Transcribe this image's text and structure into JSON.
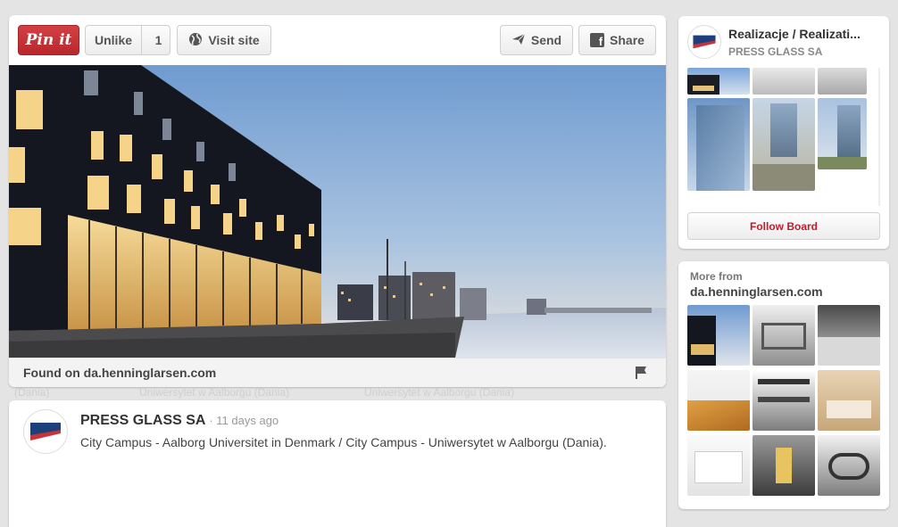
{
  "pin": {
    "pin_it_label": "Pin it",
    "unlike_label": "Unlike",
    "like_count": "1",
    "visit_label": "Visit site",
    "send_label": "Send",
    "share_label": "Share",
    "found_on": "Found on da.henninglarsen.com"
  },
  "description": {
    "author": "PRESS GLASS SA",
    "time": "· 11 days ago",
    "text": "City Campus - Aalborg Universitet in Denmark / City Campus - Uniwersytet w Aalborgu (Dania)."
  },
  "board": {
    "title": "Realizacje / Realizati...",
    "owner": "PRESS GLASS SA",
    "follow_label": "Follow Board"
  },
  "more": {
    "label": "More from",
    "domain": "da.henninglarsen.com"
  },
  "ghost": {
    "a": "Uniwersytet w Aalborgu (Dania)",
    "b": "Uniwersytet w Aalborgu (Dania)",
    "c": "(Dania)"
  },
  "colors": {
    "pin_red": "#c8323a",
    "follow_red": "#bd1e2c",
    "sky": "#8fb1d9"
  }
}
